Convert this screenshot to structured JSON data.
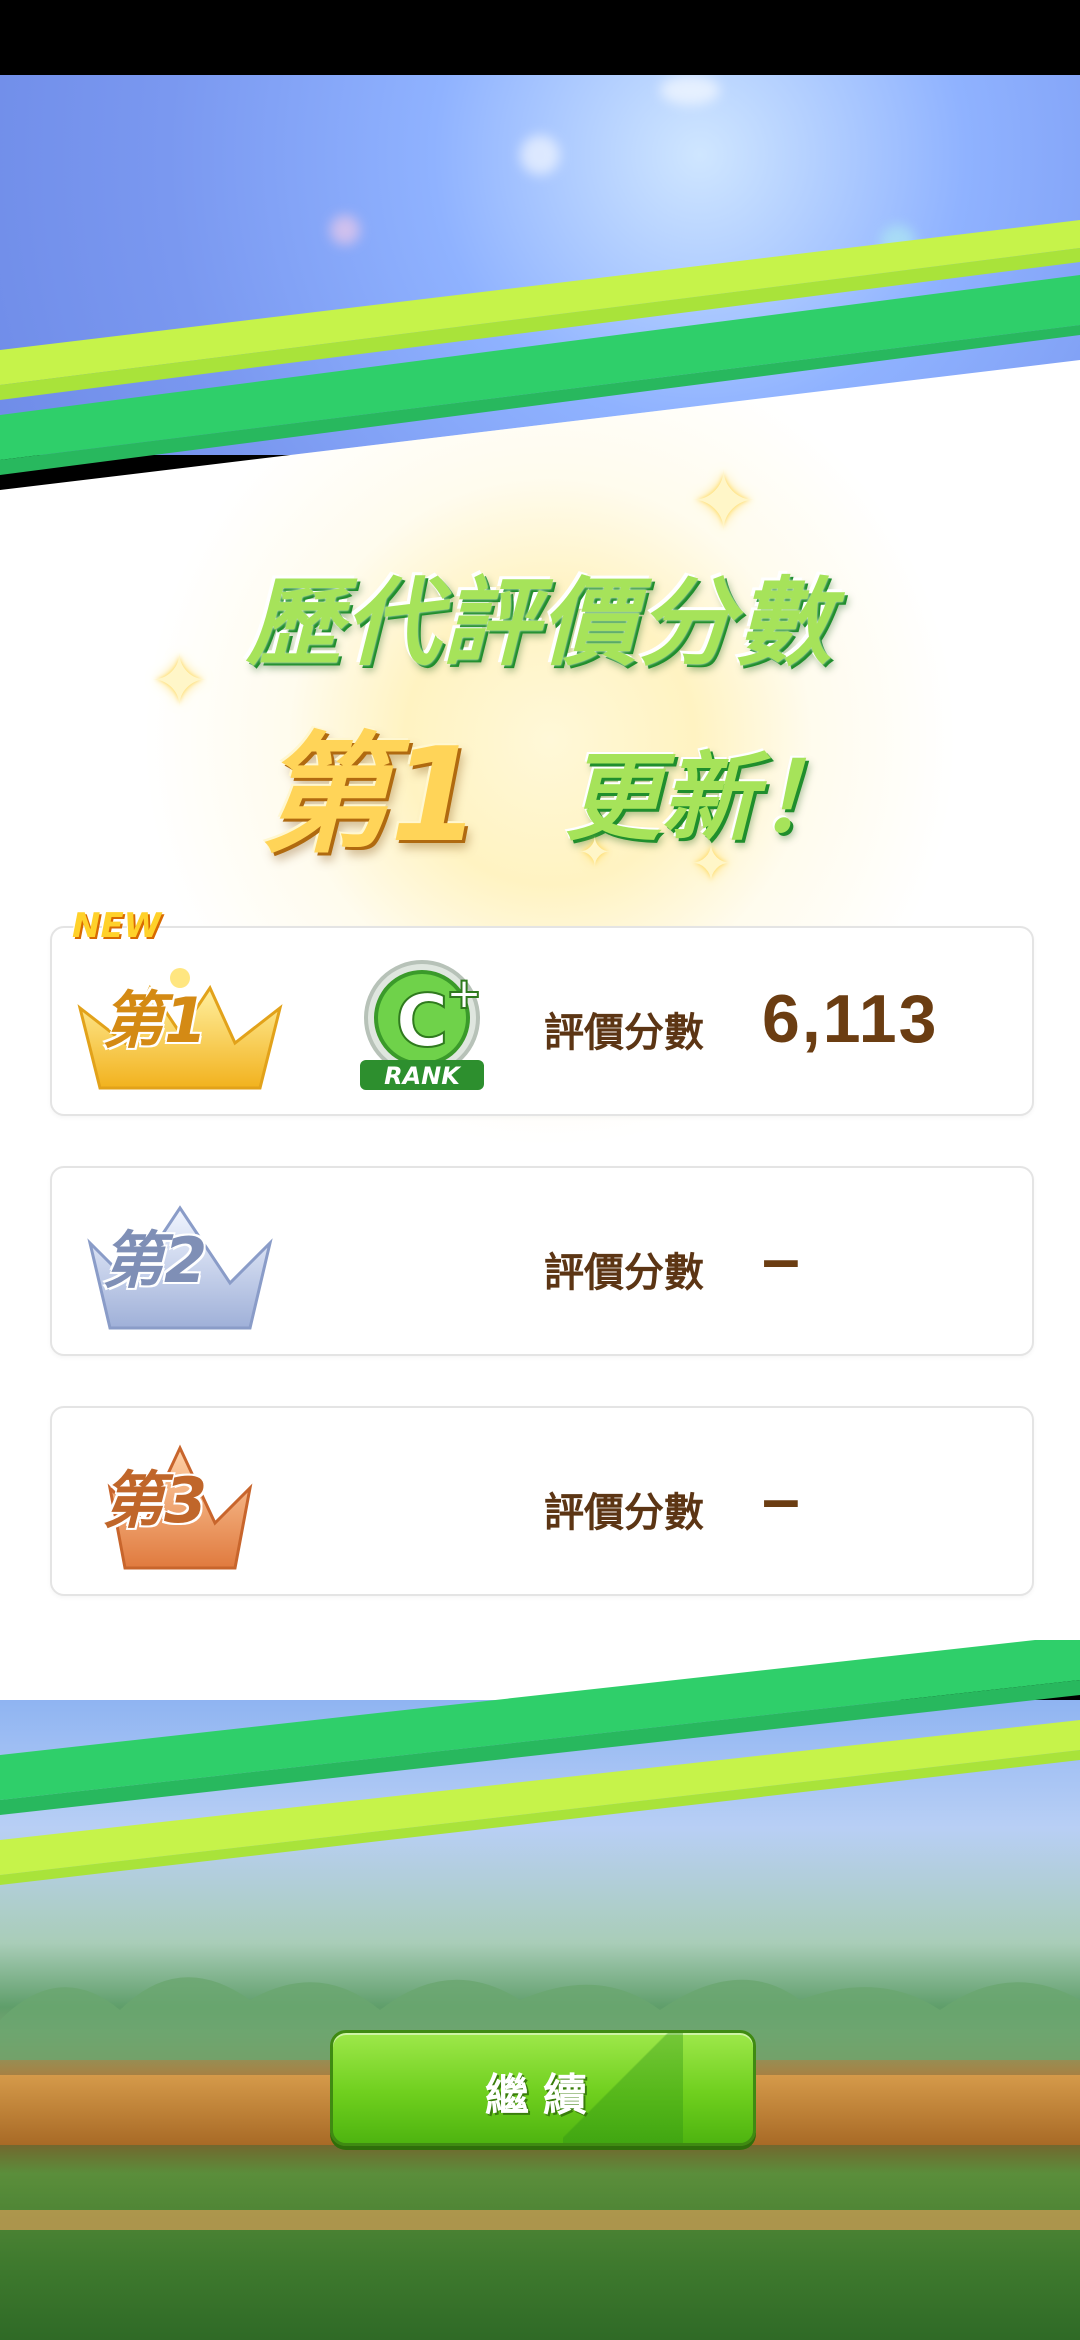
{
  "header": {
    "title_line1": "歷代評價分數",
    "rank_text": "第1",
    "update_text": "更新！"
  },
  "rows": [
    {
      "crown_text": "第1",
      "new_label": "NEW",
      "rank_grade": "C",
      "rank_modifier": "+",
      "rank_word": "RANK",
      "score_label": "評價分數",
      "score_value": "6,113"
    },
    {
      "crown_text": "第2",
      "score_label": "評價分數",
      "score_value": "–"
    },
    {
      "crown_text": "第3",
      "score_label": "評價分數",
      "score_value": "–"
    }
  ],
  "footer": {
    "continue_label": "繼續"
  },
  "colors": {
    "gold": "#ffd458",
    "silver": "#9fb0d8",
    "bronze": "#e8955a",
    "accent_green": "#6fcf1e",
    "score_brown": "#6b3d12"
  }
}
